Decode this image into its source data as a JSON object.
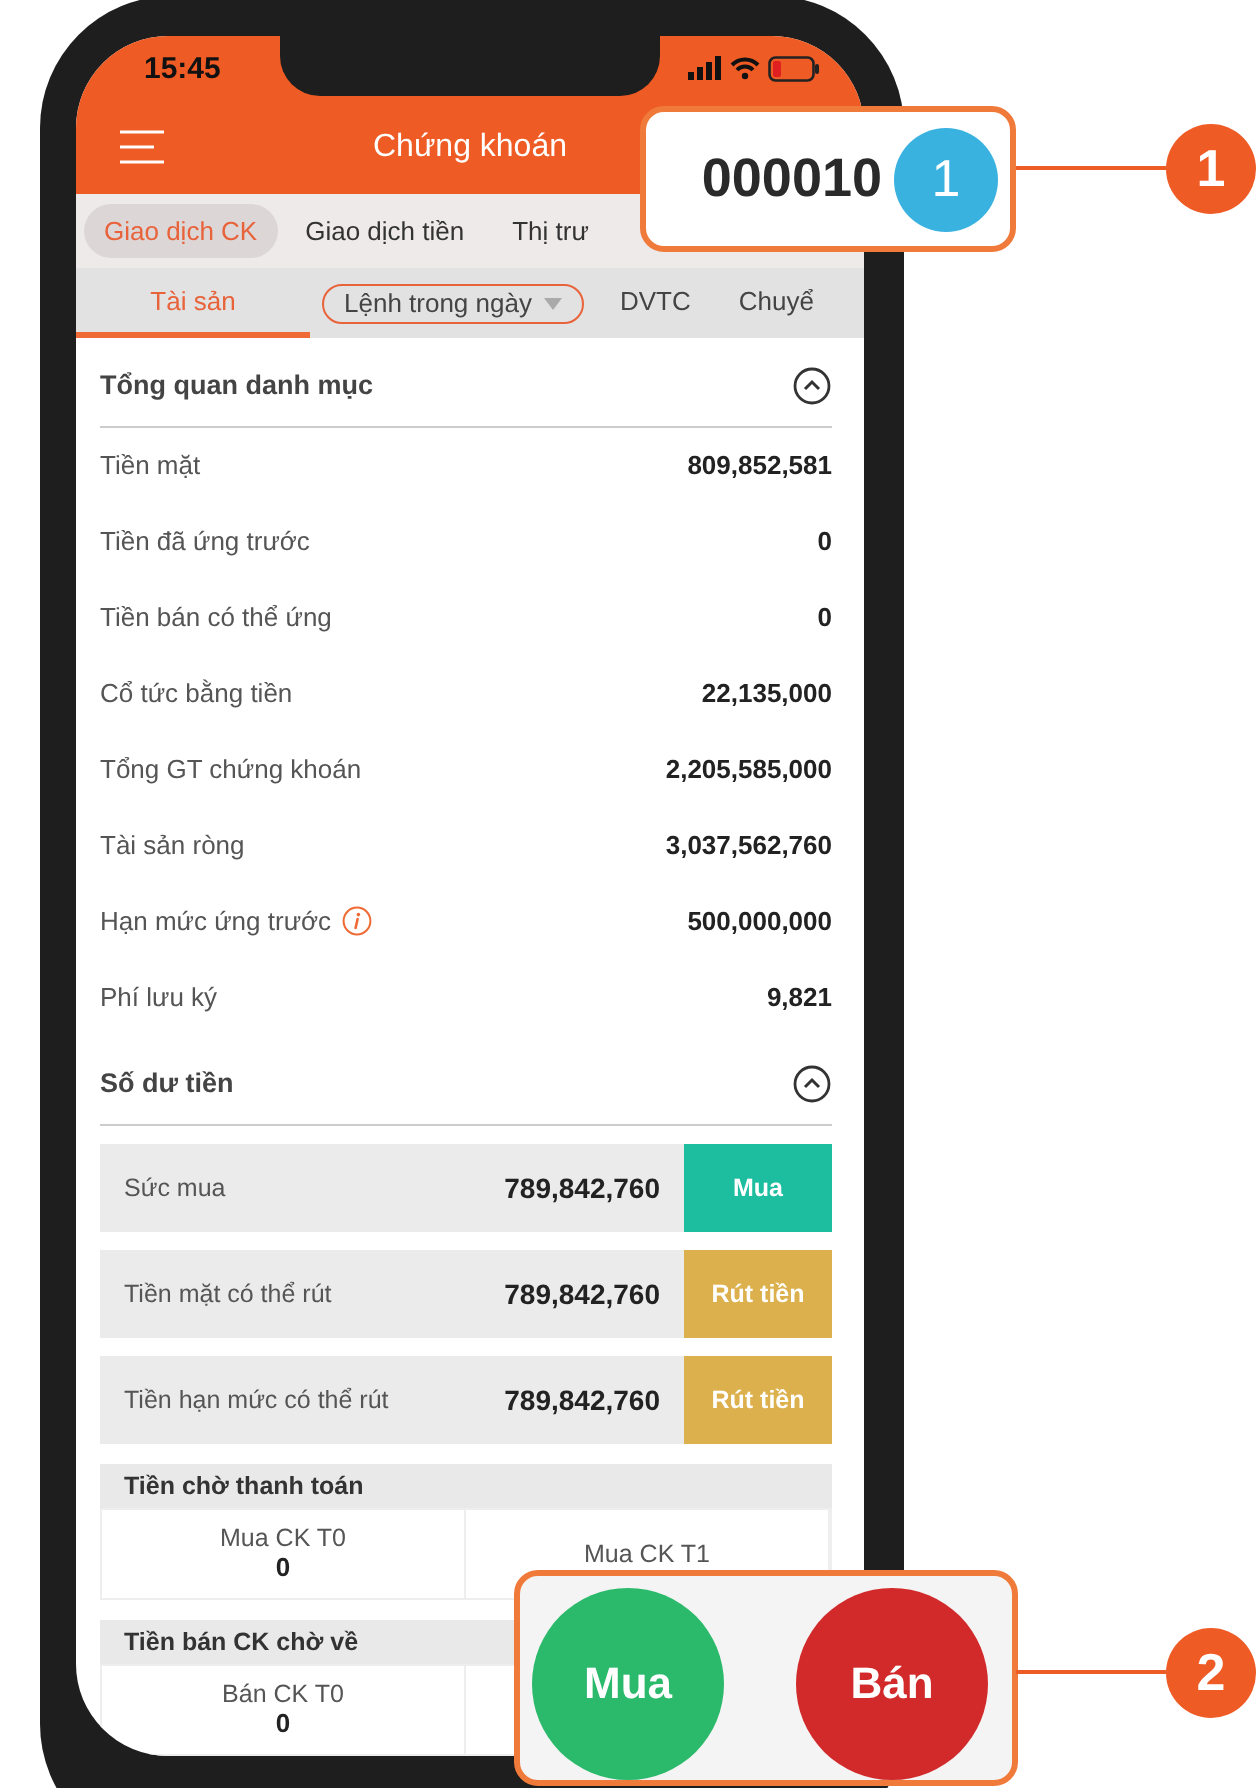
{
  "status_bar": {
    "time": "15:45"
  },
  "header": {
    "title": "Chứng khoán"
  },
  "tabs": [
    {
      "label": "Giao dịch CK",
      "selected": true
    },
    {
      "label": "Giao dịch tiền",
      "selected": false
    },
    {
      "label": "Thị trư",
      "selected": false
    }
  ],
  "subtabs": [
    {
      "label": "Tài sản",
      "selected": true,
      "kind": "plain"
    },
    {
      "label": "Lệnh trong ngày",
      "selected": false,
      "kind": "dropdown"
    },
    {
      "label": "DVTC",
      "selected": false,
      "kind": "plain"
    },
    {
      "label": "Chuyể",
      "selected": false,
      "kind": "plain"
    }
  ],
  "portfolio": {
    "title": "Tổng quan danh mục",
    "expanded": true,
    "rows": [
      {
        "label": "Tiền mặt",
        "value": "809,852,581",
        "info": false
      },
      {
        "label": "Tiền đã ứng trước",
        "value": "0",
        "info": false
      },
      {
        "label": "Tiền bán có thể ứng",
        "value": "0",
        "info": false
      },
      {
        "label": "Cổ tức bằng tiền",
        "value": "22,135,000",
        "info": false
      },
      {
        "label": "Tổng GT chứng khoán",
        "value": "2,205,585,000",
        "info": false
      },
      {
        "label": "Tài sản ròng",
        "value": "3,037,562,760",
        "info": false
      },
      {
        "label": "Hạn mức ứng trước",
        "value": "500,000,000",
        "info": true
      },
      {
        "label": "Phí lưu ký",
        "value": "9,821",
        "info": false
      }
    ]
  },
  "cash_balance": {
    "title": "Số dư tiền",
    "expanded": true,
    "rows": [
      {
        "label": "Sức mua",
        "value": "789,842,760",
        "button": "Mua",
        "kind": "buy"
      },
      {
        "label": "Tiền mặt có thể rút",
        "value": "789,842,760",
        "button": "Rút tiền",
        "kind": "withdraw"
      },
      {
        "label": "Tiền hạn mức có thể rút",
        "value": "789,842,760",
        "button": "Rút tiền",
        "kind": "withdraw"
      }
    ]
  },
  "pending": [
    {
      "title": "Tiền chờ thanh toán",
      "cells": [
        {
          "label": "Mua CK T0",
          "value": "0"
        },
        {
          "label": "Mua CK T1"
        }
      ]
    },
    {
      "title": "Tiền bán CK chờ về",
      "cells": [
        {
          "label": "Bán CK T0",
          "value": "0"
        }
      ]
    }
  ],
  "callouts": [
    {
      "number": "1",
      "kind": "account",
      "account": "000010",
      "badge": "1"
    },
    {
      "number": "2",
      "kind": "trade_buttons",
      "buttons": [
        {
          "label": "Mua",
          "kind": "buy"
        },
        {
          "label": "Bán",
          "kind": "sell"
        }
      ]
    }
  ]
}
